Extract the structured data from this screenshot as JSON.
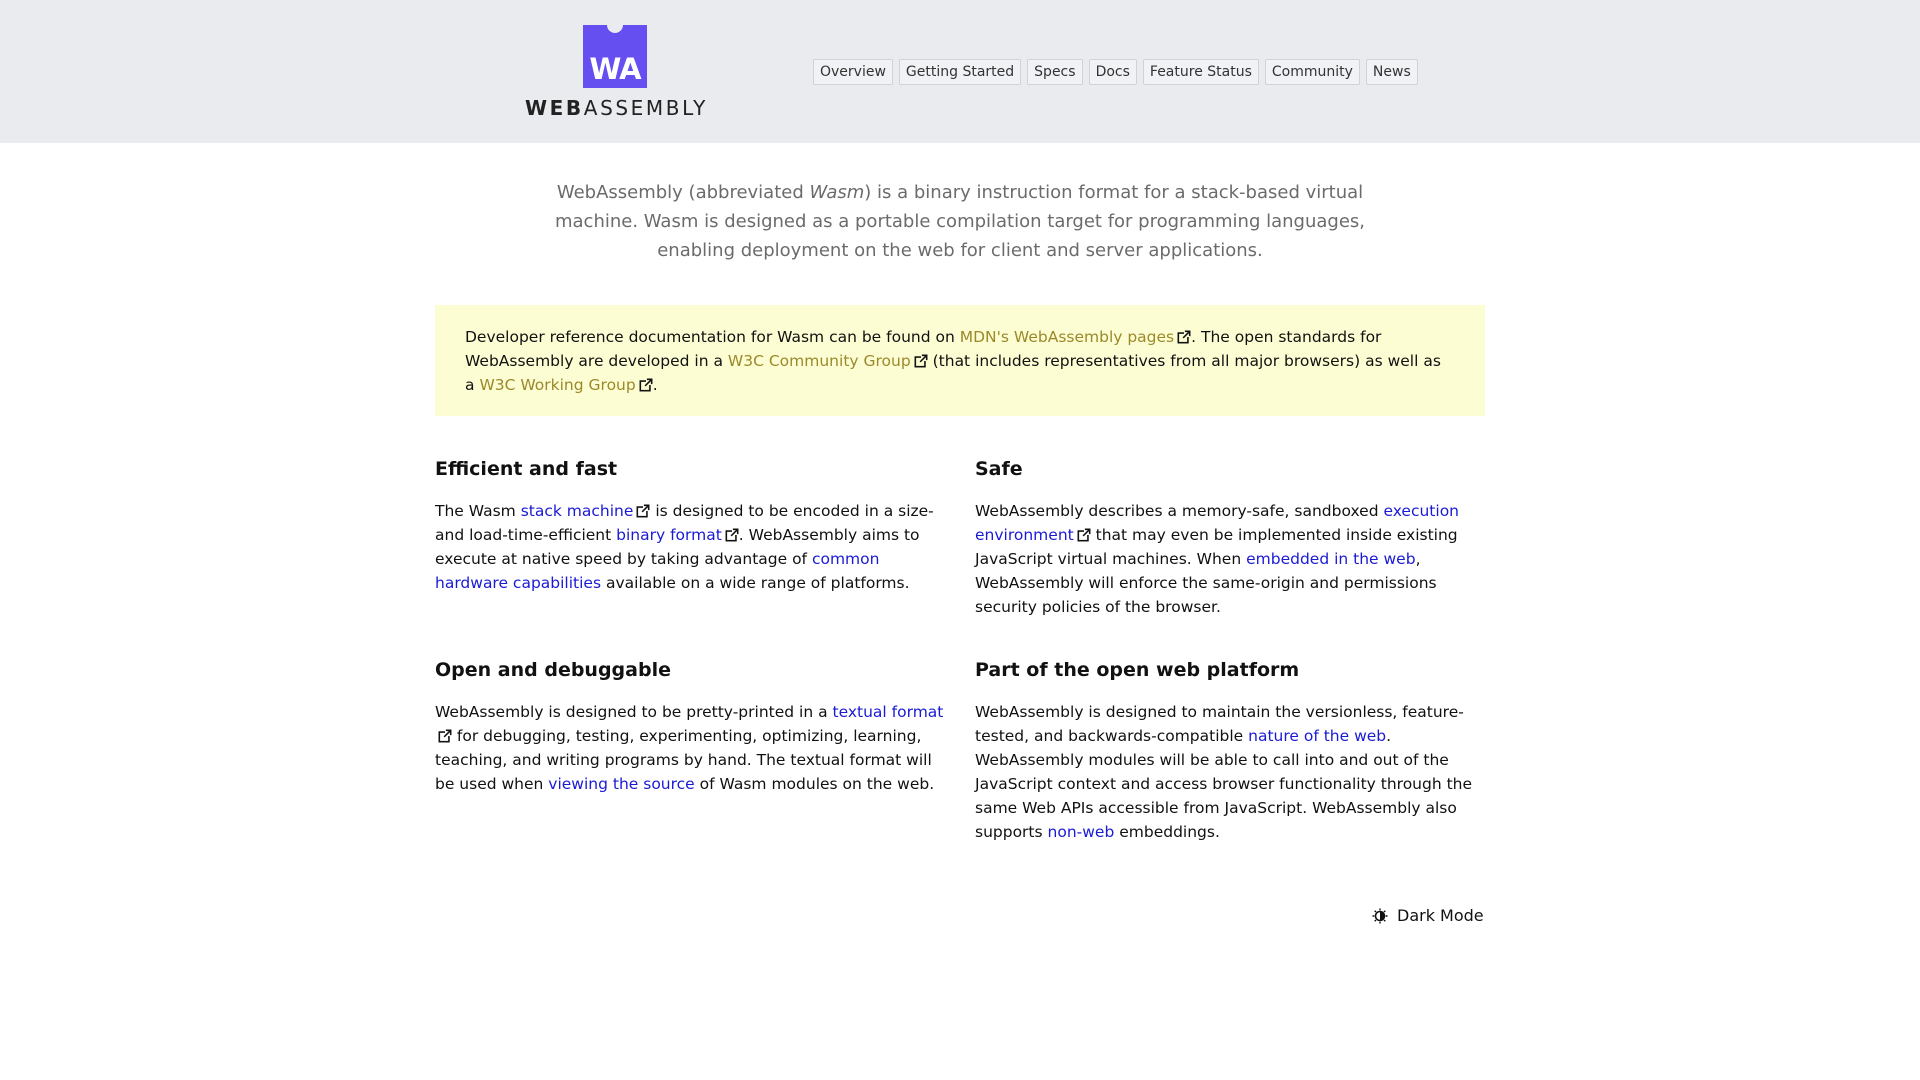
{
  "logo": {
    "mark": "WA",
    "word_bold": "WEB",
    "word_rest": "ASSEMBLY"
  },
  "nav": {
    "items": [
      {
        "label": "Overview"
      },
      {
        "label": "Getting Started"
      },
      {
        "label": "Specs"
      },
      {
        "label": "Docs"
      },
      {
        "label": "Feature Status"
      },
      {
        "label": "Community"
      },
      {
        "label": "News"
      }
    ]
  },
  "intro": {
    "text_before": "WebAssembly (abbreviated ",
    "italic": "Wasm",
    "text_after": ") is a binary instruction format for a stack-based virtual machine. Wasm is designed as a portable compilation target for programming languages, enabling deployment on the web for client and server applications."
  },
  "notice": {
    "t1": "Developer reference documentation for Wasm can be found on ",
    "link1": "MDN's WebAssembly pages",
    "t2": ". The open standards for WebAssembly are developed in a ",
    "link2": "W3C Community Group",
    "t3": " (that includes representatives from all major browsers) as well as a ",
    "link3": "W3C Working Group",
    "t4": "."
  },
  "features": {
    "efficient": {
      "title": "Efficient and fast",
      "t1": "The Wasm ",
      "link1": "stack machine",
      "t2": " is designed to be encoded in a size- and load-time-efficient ",
      "link2": "binary format",
      "t3": ". WebAssembly aims to execute at native speed by taking advantage of ",
      "link3": "common hardware capabilities",
      "t4": " available on a wide range of platforms."
    },
    "safe": {
      "title": "Safe",
      "t1": "WebAssembly describes a memory-safe, sandboxed ",
      "link1": "execution environment",
      "t2": " that may even be implemented inside existing JavaScript virtual machines. When ",
      "link2": "embedded in the web",
      "t3": ", WebAssembly will enforce the same-origin and permissions security policies of the browser."
    },
    "open": {
      "title": "Open and debuggable",
      "t1": "WebAssembly is designed to be pretty-printed in a ",
      "link1": "textual format",
      "t2": " for debugging, testing, experimenting, optimizing, learning, teaching, and writing programs by hand. The textual format will be used when ",
      "link2": "viewing the source",
      "t3": " of Wasm modules on the web."
    },
    "platform": {
      "title": "Part of the open web platform",
      "t1": "WebAssembly is designed to maintain the versionless, feature-tested, and backwards-compatible ",
      "link1": "nature of the web",
      "t2": ". WebAssembly modules will be able to call into and out of the JavaScript context and access browser functionality through the same Web APIs accessible from JavaScript. WebAssembly also supports ",
      "link2": "non-web",
      "t3": " embeddings."
    }
  },
  "footer": {
    "dark_mode_label": "Dark Mode"
  },
  "colors": {
    "header_bg": "#e9ebef",
    "logo_purple": "#654ff0",
    "notice_bg": "#fdfdd4",
    "notice_link": "#9a8a2a",
    "body_link": "#1a1ad6"
  },
  "icons": [
    "external-link-icon",
    "contrast-icon"
  ]
}
